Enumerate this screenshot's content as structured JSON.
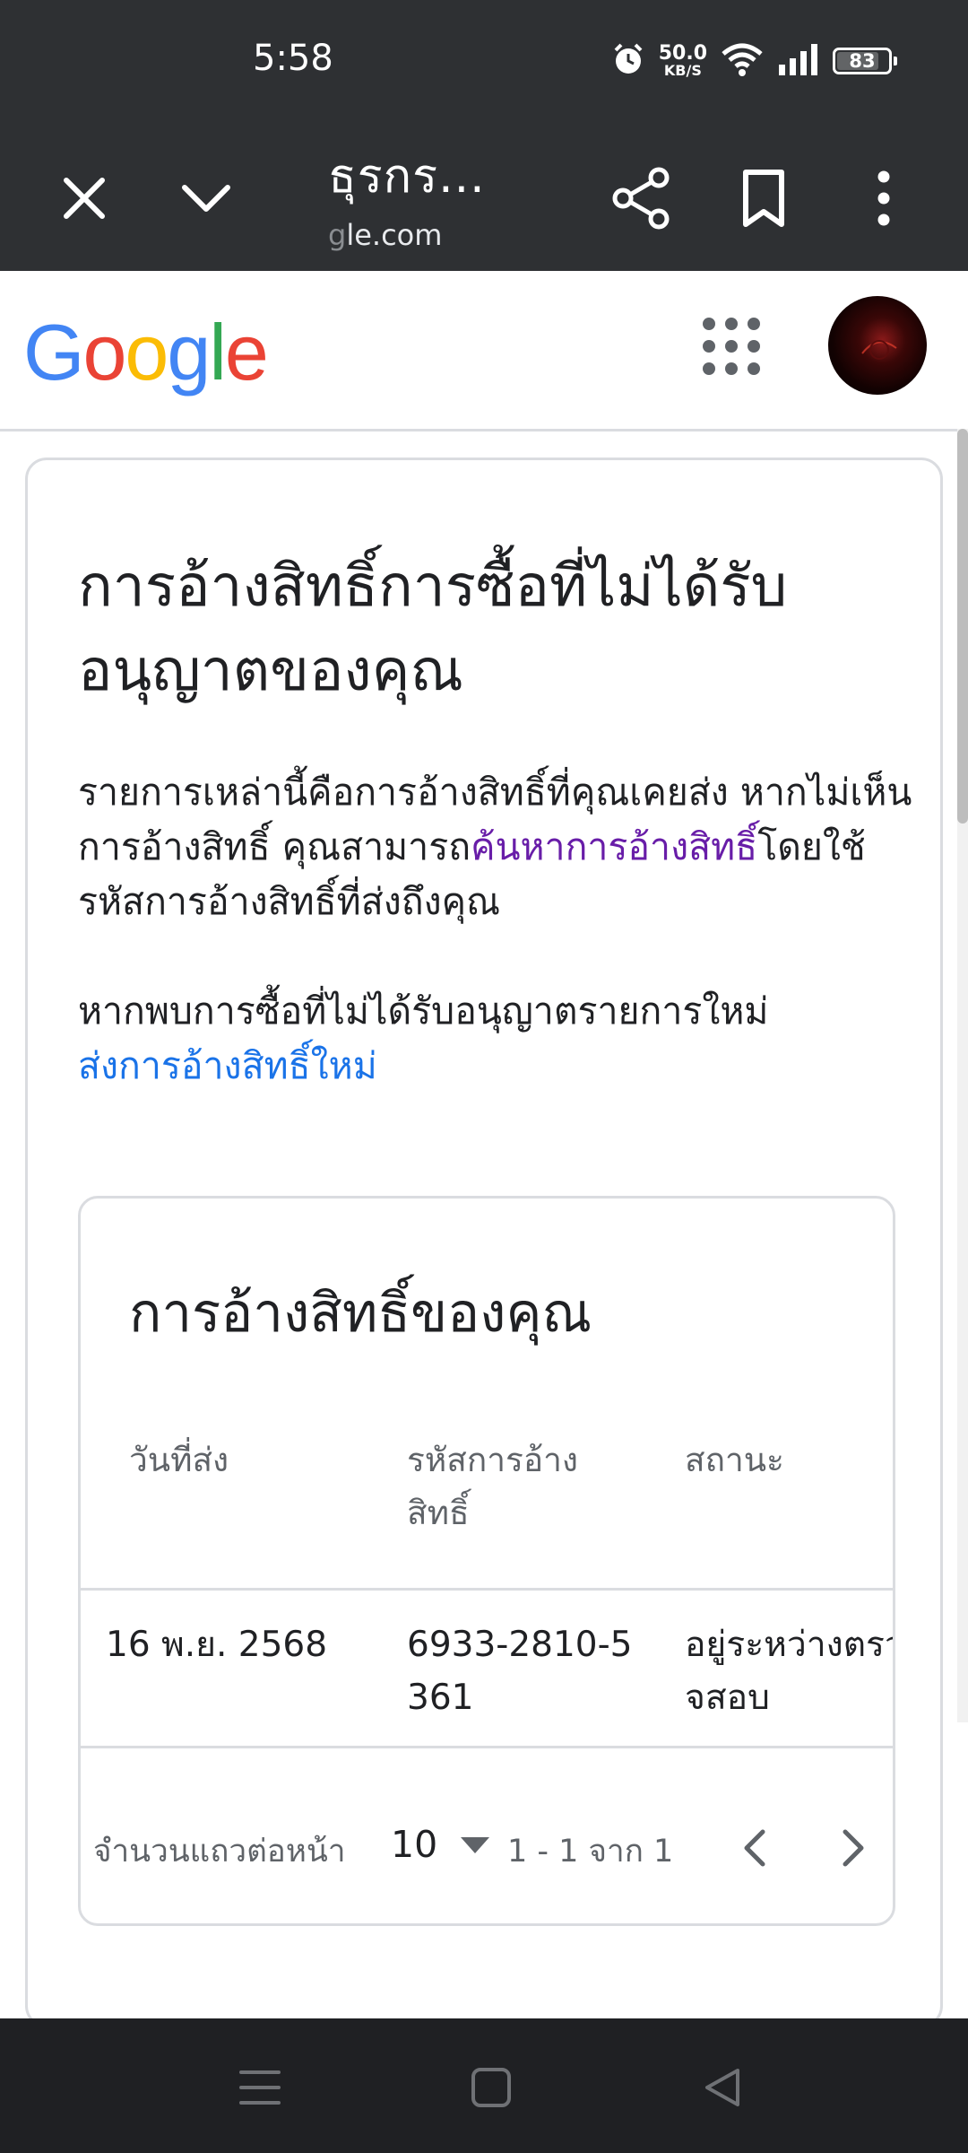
{
  "status_bar": {
    "time": "5:58",
    "speed_value": "50.0",
    "speed_unit": "KB/S",
    "battery": "83",
    "battery_level_percent": 83,
    "icons": [
      "alarm-icon",
      "wifi-icon",
      "signal-icon",
      "battery-icon"
    ]
  },
  "toolbar": {
    "title": "ธุรกร...",
    "url_faded": "g",
    "url": "le.com",
    "icons": [
      "close-icon",
      "chevron-down-icon",
      "share-icon",
      "bookmark-icon",
      "more-vert-icon"
    ]
  },
  "header": {
    "logo_letters": [
      "G",
      "o",
      "o",
      "g",
      "l",
      "e"
    ],
    "colors": {
      "blue": "#4285F4",
      "red": "#EA4335",
      "yellow": "#FBBC05",
      "green": "#34A853"
    },
    "icons": [
      "apps-grid-icon",
      "avatar"
    ]
  },
  "main": {
    "title": "การอ้างสิทธิ์การซื้อที่ไม่ได้รับอนุญาตของคุณ",
    "intro_1": "รายการเหล่านี้คือการอ้างสิทธิ์ที่คุณเคยส่ง หากไม่เห็นการอ้างสิทธิ์ คุณสามารถ",
    "intro_link": "ค้นหาการอ้างสิทธิ์",
    "intro_2": "โดยใช้รหัสการอ้างสิทธิ์ที่ส่งถึงคุณ",
    "new_claim_text": "หากพบการซื้อที่ไม่ได้รับอนุญาตรายการใหม่",
    "new_claim_link": "ส่งการอ้างสิทธิ์ใหม่",
    "link_colors": {
      "visited": "#681DA8",
      "link": "#1A73E8"
    }
  },
  "claims": {
    "title": "การอ้างสิทธิ์ของคุณ",
    "columns": [
      "วันที่ส่ง",
      "รหัสการอ้างสิทธิ์",
      "สถานะ"
    ],
    "rows": [
      {
        "date": "16 พ.ย. 2568",
        "claim_id": "6933-2810-5361",
        "status": "อยู่ระหว่างตรวจสอบ"
      }
    ],
    "rows_per_page_label": "จำนวนแถวต่อหน้า",
    "rows_per_page_value": "10",
    "range": "1 - 1 จาก 1"
  },
  "nav_bar": {
    "icons": [
      "menu-icon",
      "home-icon",
      "back-icon"
    ]
  }
}
